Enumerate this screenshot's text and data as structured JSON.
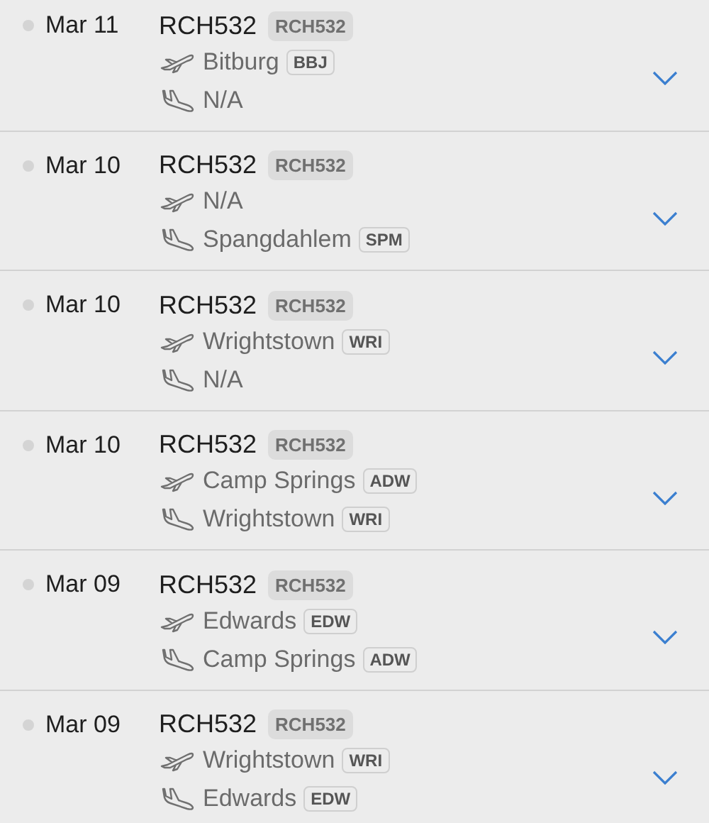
{
  "flights": [
    {
      "date": "Mar 11",
      "callsign": "RCH532",
      "callsign_tag": "RCH532",
      "departure": {
        "place": "Bitburg",
        "code": "BBJ"
      },
      "arrival": {
        "place": "N/A"
      }
    },
    {
      "date": "Mar 10",
      "callsign": "RCH532",
      "callsign_tag": "RCH532",
      "departure": {
        "place": "N/A"
      },
      "arrival": {
        "place": "Spangdahlem",
        "code": "SPM"
      }
    },
    {
      "date": "Mar 10",
      "callsign": "RCH532",
      "callsign_tag": "RCH532",
      "departure": {
        "place": "Wrightstown",
        "code": "WRI"
      },
      "arrival": {
        "place": "N/A"
      }
    },
    {
      "date": "Mar 10",
      "callsign": "RCH532",
      "callsign_tag": "RCH532",
      "departure": {
        "place": "Camp Springs",
        "code": "ADW"
      },
      "arrival": {
        "place": "Wrightstown",
        "code": "WRI"
      }
    },
    {
      "date": "Mar 09",
      "callsign": "RCH532",
      "callsign_tag": "RCH532",
      "departure": {
        "place": "Edwards",
        "code": "EDW"
      },
      "arrival": {
        "place": "Camp Springs",
        "code": "ADW"
      }
    },
    {
      "date": "Mar 09",
      "callsign": "RCH532",
      "callsign_tag": "RCH532",
      "departure": {
        "place": "Wrightstown",
        "code": "WRI"
      },
      "arrival": {
        "place": "Edwards",
        "code": "EDW"
      }
    }
  ]
}
